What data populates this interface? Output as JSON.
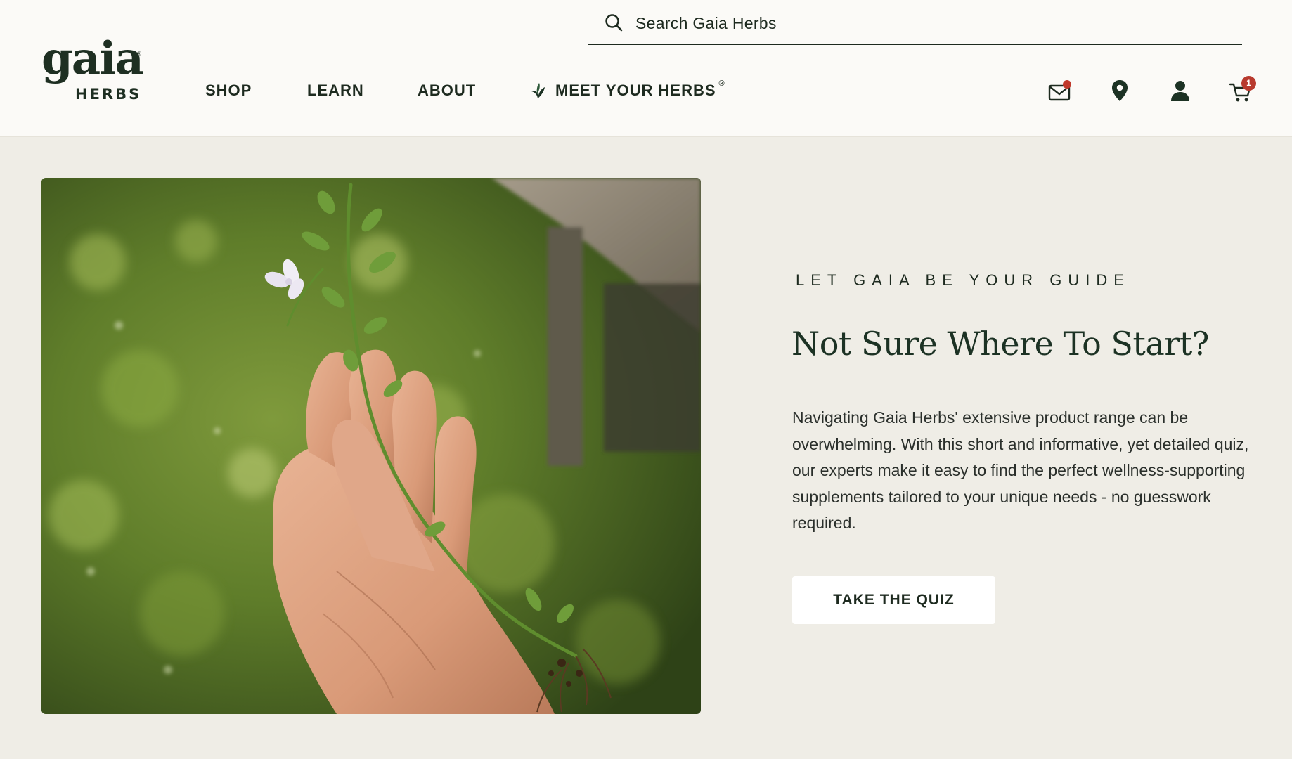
{
  "brand": {
    "logo_word": "gaia",
    "logo_sub": "HERBS",
    "logo_reg": "®"
  },
  "search": {
    "placeholder": "Search Gaia Herbs",
    "icon": "search-icon"
  },
  "nav": {
    "items": [
      {
        "label": "SHOP"
      },
      {
        "label": "LEARN"
      },
      {
        "label": "ABOUT"
      },
      {
        "label": "MEET YOUR HERBS",
        "superscript": "®",
        "icon": "leaf-icon"
      }
    ]
  },
  "header_icons": {
    "mail": "mail-icon",
    "location": "location-pin-icon",
    "account": "user-icon",
    "cart": "cart-icon",
    "cart_count": "1"
  },
  "colors": {
    "header_bg": "#fbfaf7",
    "page_bg": "#efede6",
    "text_dark": "#1d2a1f",
    "heading_green": "#1c3224",
    "badge_red": "#b83a2e",
    "button_bg": "#ffffff"
  },
  "hero": {
    "image": "hand-holding-herb-photo",
    "eyebrow": "LET GAIA BE YOUR GUIDE",
    "headline": "Not Sure Where To Start?",
    "body": "Navigating Gaia Herbs' extensive product range can be overwhelming. With this short and informative, yet detailed quiz, our experts make it easy to find the perfect wellness-supporting supplements tailored to your unique needs - no guesswork required.",
    "cta_label": "TAKE THE QUIZ"
  }
}
